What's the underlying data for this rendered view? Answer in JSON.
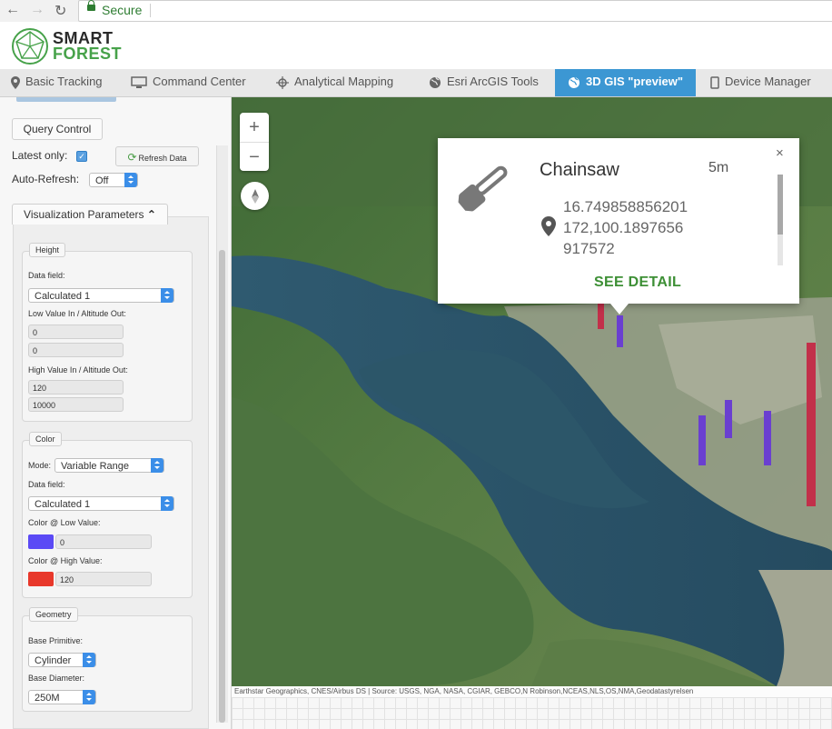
{
  "browser": {
    "secure_label": "Secure",
    "back": "←",
    "forward": "→",
    "reload": "↻"
  },
  "brand": {
    "line1": "SMART",
    "line2": "FOREST"
  },
  "tabs": [
    {
      "label": "Basic Tracking",
      "icon": "map-pin-icon"
    },
    {
      "label": "Command Center",
      "icon": "monitor-icon"
    },
    {
      "label": "Analytical Mapping",
      "icon": "crosshair-icon"
    },
    {
      "label": "Esri ArcGIS Tools",
      "icon": "globe-icon"
    },
    {
      "label": "3D GIS \"preview\"",
      "icon": "globe-icon",
      "active": true
    },
    {
      "label": "Device Manager",
      "icon": "device-icon"
    }
  ],
  "left_panel": {
    "query_control": "Query Control",
    "latest_only": "Latest only:",
    "latest_only_checked": true,
    "refresh_button": "Refresh Data",
    "auto_refresh": "Auto-Refresh:",
    "auto_refresh_value": "Off",
    "vis_params": "Visualization Parameters",
    "height": {
      "title": "Height",
      "data_field_label": "Data field:",
      "data_field_value": "Calculated 1",
      "low_label": "Low Value In / Altitude Out:",
      "low_in": "0",
      "low_out": "0",
      "high_label": "High Value In / Altitude Out:",
      "high_in": "120",
      "high_out": "10000"
    },
    "color": {
      "title": "Color",
      "mode_label": "Mode:",
      "mode_value": "Variable Range",
      "data_field_label": "Data field:",
      "data_field_value": "Calculated 1",
      "low_label": "Color @ Low Value:",
      "low_value": "0",
      "low_color": "#5b4af5",
      "high_label": "Color @ High Value:",
      "high_value": "120",
      "high_color": "#e8382b"
    },
    "geometry": {
      "title": "Geometry",
      "primitive_label": "Base Primitive:",
      "primitive_value": "Cylinder",
      "diameter_label": "Base Diameter:",
      "diameter_value": "250M"
    }
  },
  "map": {
    "zoom_in": "+",
    "zoom_out": "−",
    "popup": {
      "title": "Chainsaw",
      "time": "5m",
      "close": "×",
      "coord_lines": [
        "16.749858856201",
        "172,100.1897656",
        "917572"
      ],
      "detail": "SEE DETAIL"
    },
    "attribution": "Earthstar Geographics, CNES/Airbus DS | Source: USGS, NGA, NASA, CGIAR, GEBCO,N Robinson,NCEAS,NLS,OS,NMA,Geodatastyrelsen"
  },
  "colors": {
    "accent": "#3c97d3",
    "brand_green": "#47a24a",
    "detail_green": "#3d8f35"
  }
}
